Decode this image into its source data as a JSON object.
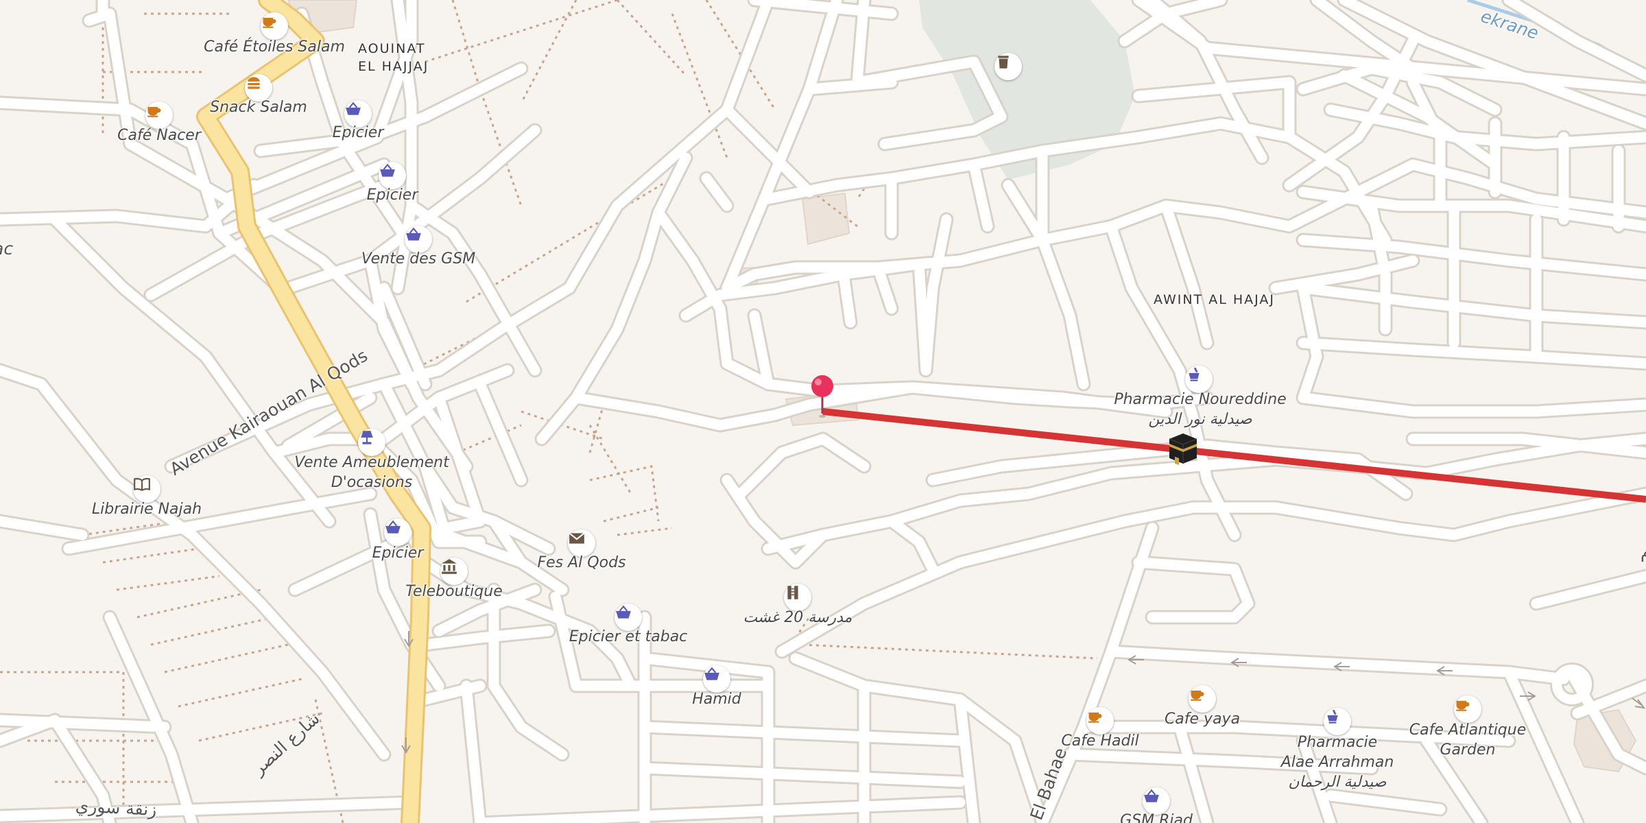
{
  "map": {
    "colors": {
      "land": "#f7f4f0",
      "road_fill": "#ffffff",
      "road_casing": "#d9d2c9",
      "primary_fill": "#fbe3a0",
      "primary_casing": "#e9c36f",
      "path": "#c7a58d",
      "park": "#e1e6e0",
      "building": "#ece4da",
      "route": "#d63434",
      "pin": "#e8315c",
      "water": "#a8cbe6",
      "poi_food": "#d07a1a",
      "poi_shop": "#5a5bb8",
      "poi_misc": "#6b5545"
    },
    "areas": [
      {
        "name": "area-aouinat-el-hajjaj",
        "lines": [
          "AOUINAT",
          "EL HAJJAJ"
        ]
      },
      {
        "name": "area-awint-al-hajaj",
        "lines": [
          "AWINT AL HAJAJ"
        ]
      }
    ],
    "streets": [
      {
        "name": "street-avenue-kairaouan-al-qods",
        "text": "Avenue Kairaouan Al Qods"
      },
      {
        "name": "street-el-bahae",
        "text": "El Bahae"
      },
      {
        "name": "street-arabic-annasr",
        "text": "شارع النصر"
      },
      {
        "name": "street-arabic-souri",
        "text": "زنقة سوري"
      },
      {
        "name": "waterway-ekrane",
        "text": "ekrane"
      },
      {
        "name": "edge-label-left",
        "text": "ac"
      },
      {
        "name": "edge-label-right",
        "text": "م"
      }
    ],
    "pois": [
      {
        "name": "poi-cafe-etoiles-salam",
        "icon": "cafe",
        "label": "Café Étoiles Salam"
      },
      {
        "name": "poi-snack-salam",
        "icon": "fast-food",
        "label": "Snack Salam"
      },
      {
        "name": "poi-cafe-nacer",
        "icon": "cafe",
        "label": "Café Nacer"
      },
      {
        "name": "poi-epicier-1",
        "icon": "shop",
        "label": "Epicier"
      },
      {
        "name": "poi-epicier-2",
        "icon": "shop",
        "label": "Epicier"
      },
      {
        "name": "poi-vente-des-gsm",
        "icon": "shop",
        "label": "Vente des GSM"
      },
      {
        "name": "poi-vente-ameublement",
        "icon": "furniture",
        "label": "Vente Ameublement\nD'ocasions"
      },
      {
        "name": "poi-librairie-najah",
        "icon": "book",
        "label": "Librairie Najah"
      },
      {
        "name": "poi-epicier-3",
        "icon": "shop",
        "label": "Epicier"
      },
      {
        "name": "poi-teleboutique",
        "icon": "building",
        "label": "Teleboutique"
      },
      {
        "name": "poi-fes-al-qods",
        "icon": "post",
        "label": "Fes Al Qods"
      },
      {
        "name": "poi-epicier-et-tabac",
        "icon": "shop",
        "label": "Epicier et tabac"
      },
      {
        "name": "poi-hamid",
        "icon": "shop",
        "label": "Hamid"
      },
      {
        "name": "poi-madrasa-20-aout",
        "icon": "school",
        "label": "مدرسة 20 غشت"
      },
      {
        "name": "poi-pharmacie-noureddine",
        "icon": "pharmacy",
        "label": "Pharmacie Noureddine\nصيدلية نور الدين"
      },
      {
        "name": "poi-cafe-hadil",
        "icon": "cafe",
        "label": "Cafe Hadil"
      },
      {
        "name": "poi-cafe-yaya",
        "icon": "cafe",
        "label": "Cafe yaya"
      },
      {
        "name": "poi-pharmacie-alae-arrahman",
        "icon": "pharmacy",
        "label": "Pharmacie\nAlae Arrahman\nصيدلية الرحمان"
      },
      {
        "name": "poi-cafe-atlantique-garden",
        "icon": "cafe",
        "label": "Cafe Atlantique\nGarden"
      },
      {
        "name": "poi-gsm-riad",
        "icon": "shop",
        "label": "GSM Riad"
      },
      {
        "name": "poi-waste-basket",
        "icon": "waste",
        "label": ""
      }
    ]
  }
}
